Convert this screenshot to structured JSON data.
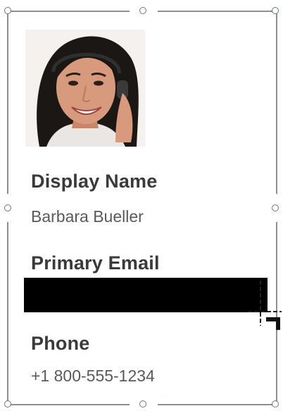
{
  "contact_card": {
    "display_name_label": "Display Name",
    "display_name_value": "Barbara Bueller",
    "primary_email_label": "Primary Email",
    "primary_email_value": "",
    "phone_label": "Phone",
    "phone_value": "+1 800-555-1234"
  },
  "icons": {
    "avatar": "profile-photo",
    "cursor": "resize-crosshair-icon"
  }
}
